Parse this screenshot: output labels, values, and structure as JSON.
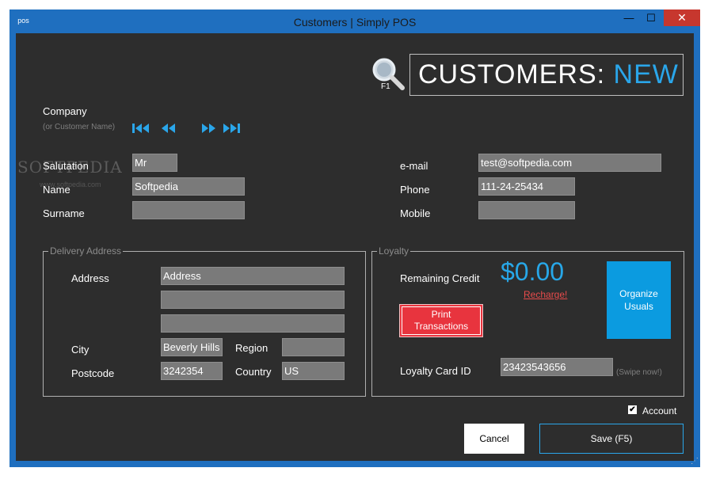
{
  "window": {
    "title": "Customers | Simply POS",
    "icon_glyph": "pos",
    "min_glyph": "—",
    "max_glyph": "☐",
    "close_glyph": "✕",
    "grip_glyph": "⋰"
  },
  "header": {
    "search_shortcut": "F1",
    "title_prefix": "CUSTOMERS:",
    "title_state": "NEW"
  },
  "watermark": {
    "brand": "SOFTPEDIA",
    "site": "www.softpedia.com"
  },
  "company": {
    "label": "Company",
    "hint": "(or Customer Name)",
    "nav_icons": [
      "first-record-icon",
      "previous-record-icon",
      "next-record-icon",
      "last-record-icon"
    ]
  },
  "customer": {
    "salutation_label": "Salutation",
    "salutation_value": "Mr",
    "name_label": "Name",
    "name_value": "Softpedia",
    "surname_label": "Surname",
    "surname_value": "",
    "email_label": "e-mail",
    "email_value": "test@softpedia.com",
    "phone_label": "Phone",
    "phone_value": "111-24-25434",
    "mobile_label": "Mobile",
    "mobile_value": ""
  },
  "delivery": {
    "legend": "Delivery Address",
    "address_label": "Address",
    "address_line1": "Address",
    "address_line2": "",
    "address_line3": "",
    "city_label": "City",
    "city_value": "Beverly Hills",
    "region_label": "Region",
    "region_value": "",
    "postcode_label": "Postcode",
    "postcode_value": "3242354",
    "country_label": "Country",
    "country_value": "US"
  },
  "loyalty": {
    "legend": "Loyalty",
    "remaining_label": "Remaining Credit",
    "credit_value": "$0.00",
    "recharge_label": "Recharge!",
    "print_label_1": "Print",
    "print_label_2": "Transactions",
    "organize_label_1": "Organize",
    "organize_label_2": "Usuals",
    "card_label": "Loyalty Card ID",
    "card_value": "23423543656",
    "swipe_hint": "(Swipe now!)"
  },
  "footer": {
    "account_label": "Account",
    "account_checked": true,
    "check_glyph": "✔",
    "cancel_label": "Cancel",
    "save_label": "Save (F5)"
  },
  "colors": {
    "accent": "#2aa6ea",
    "background": "#2d2d2d",
    "field": "#7a7a7a",
    "danger": "#e8343e",
    "frame": "#1f6fbf"
  }
}
